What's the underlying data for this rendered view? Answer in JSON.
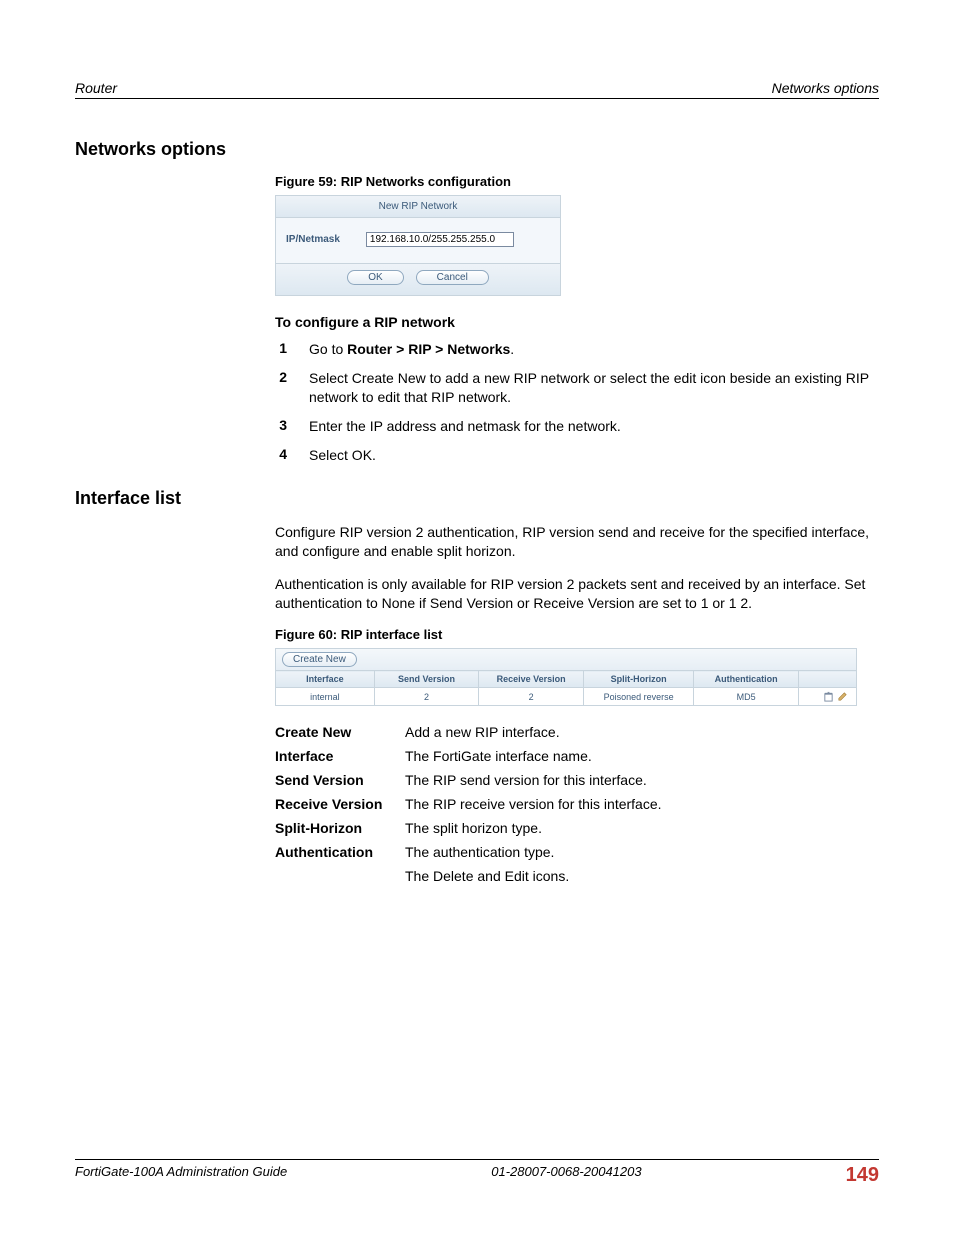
{
  "header": {
    "left": "Router",
    "right": "Networks options"
  },
  "section1": {
    "title": "Networks options",
    "figCaption": "Figure 59: RIP Networks configuration",
    "dialog": {
      "title": "New RIP Network",
      "label": "IP/Netmask",
      "value": "192.168.10.0/255.255.255.0",
      "ok": "OK",
      "cancel": "Cancel"
    },
    "subhead": "To configure a RIP network",
    "steps": [
      {
        "n": "1",
        "t_pre": "Go to ",
        "t_bold": "Router > RIP > Networks",
        "t_post": "."
      },
      {
        "n": "2",
        "t": "Select Create New to add a new RIP network or select the edit icon beside an existing RIP network to edit that RIP network."
      },
      {
        "n": "3",
        "t": "Enter the IP address and netmask for the network."
      },
      {
        "n": "4",
        "t": "Select OK."
      }
    ]
  },
  "section2": {
    "title": "Interface list",
    "para1": "Configure RIP version 2 authentication, RIP version send and receive for the specified interface, and configure and enable split horizon.",
    "para2": "Authentication is only available for RIP version 2 packets sent and received by an interface. Set authentication to None if Send Version or Receive Version are set to 1 or 1 2.",
    "figCaption": "Figure 60: RIP interface list",
    "createNew": "Create New",
    "table": {
      "headers": [
        "Interface",
        "Send Version",
        "Receive Version",
        "Split-Horizon",
        "Authentication",
        ""
      ],
      "row": {
        "c0": "internal",
        "c1": "2",
        "c2": "2",
        "c3": "Poisoned reverse",
        "c4": "MD5"
      }
    },
    "defs": [
      {
        "term": "Create New",
        "desc": "Add a new RIP interface."
      },
      {
        "term": "Interface",
        "desc": "The FortiGate interface name."
      },
      {
        "term": "Send Version",
        "desc": "The RIP send version for this interface."
      },
      {
        "term": "Receive Version",
        "desc": "The RIP receive version for this interface."
      },
      {
        "term": "Split-Horizon",
        "desc": "The split horizon type."
      },
      {
        "term": "Authentication",
        "desc": "The authentication type."
      },
      {
        "term": "",
        "desc": "The Delete and Edit icons."
      }
    ]
  },
  "footer": {
    "left": "FortiGate-100A Administration Guide",
    "center": "01-28007-0068-20041203",
    "page": "149"
  }
}
